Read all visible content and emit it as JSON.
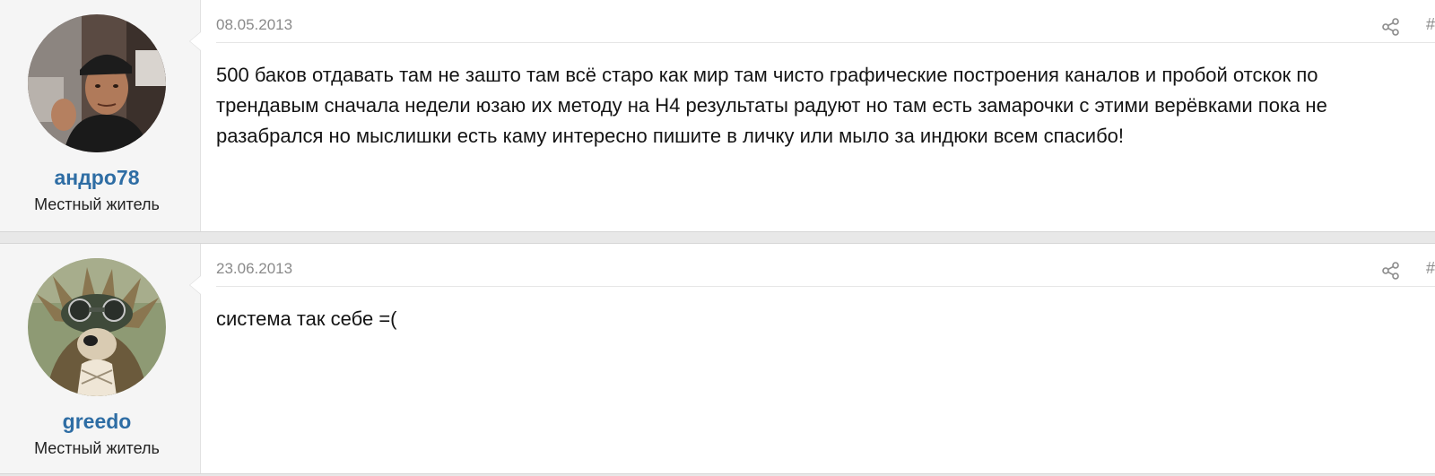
{
  "colors": {
    "username": "#2e6da4",
    "date": "#8a8a8a",
    "body_text": "#141414",
    "user_panel_bg": "#f5f5f5",
    "separator_bg": "#e8e8e8"
  },
  "posts": [
    {
      "user": {
        "name": "андро78",
        "title": "Местный житель",
        "avatar_icon": "avatar-photo-man-in-cap"
      },
      "date": "08.05.2013",
      "share_icon": "share-icon",
      "permalink": "#",
      "body": "500 баков отдавать там не зашто там всё старо как мир там чисто графические построения каналов и пробой отскок по трендавым сначала недели юзаю их методу на H4 результаты радуют но там есть замарочки с этими верёвками пока не разабрался но мыслишки есть каму интересно пишите в личку или мыло за индюки всем спасибо!"
    },
    {
      "user": {
        "name": "greedo",
        "title": "Местный житель",
        "avatar_icon": "avatar-creature-with-goggles"
      },
      "date": "23.06.2013",
      "share_icon": "share-icon",
      "permalink": "#",
      "body": "система так себе =("
    }
  ]
}
